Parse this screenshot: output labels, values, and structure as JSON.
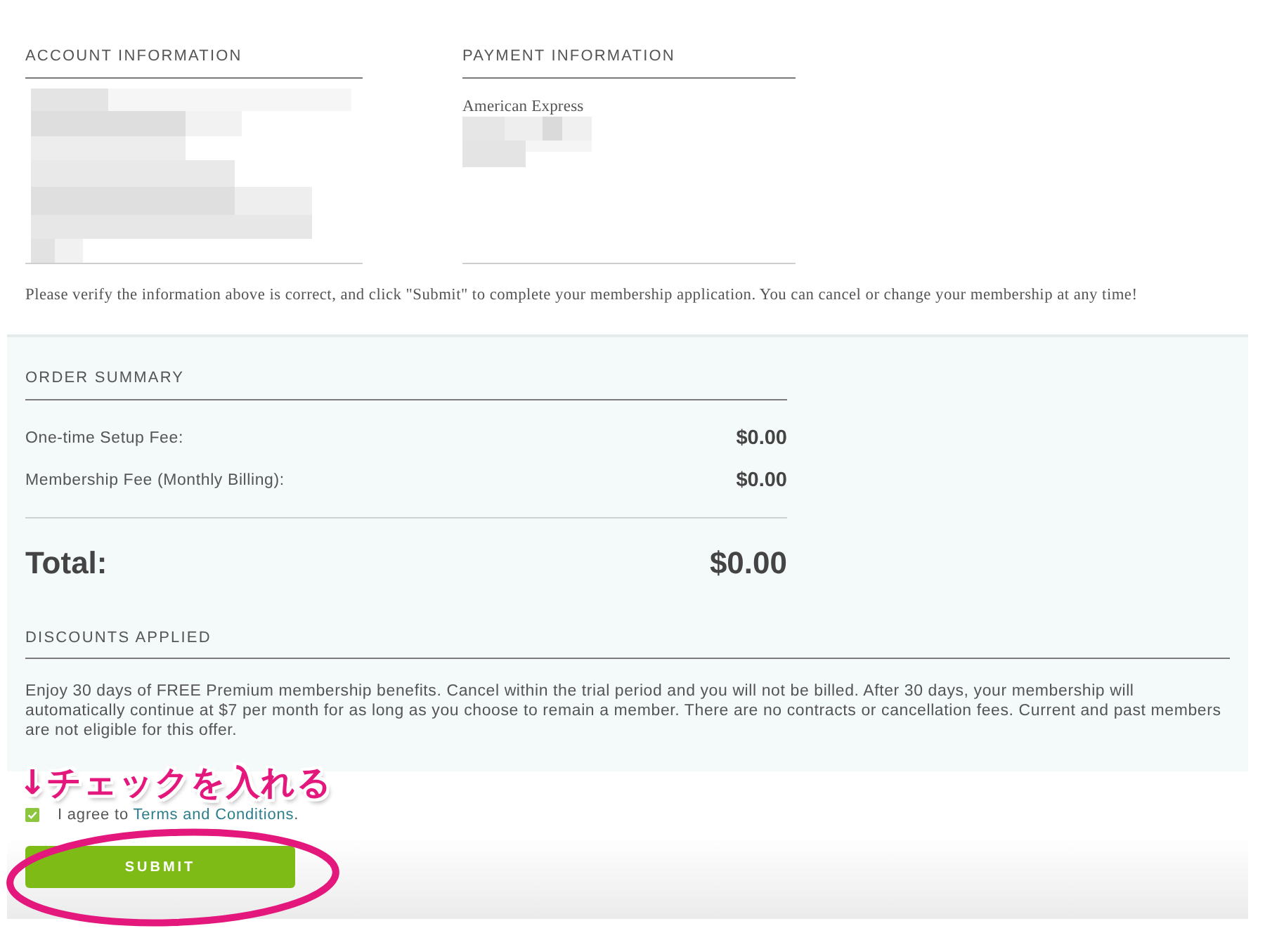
{
  "account_information": {
    "heading": "ACCOUNT INFORMATION",
    "redacted": true
  },
  "payment_information": {
    "heading": "PAYMENT INFORMATION",
    "card_type": "American Express",
    "redacted": true
  },
  "notice": "Please verify the information above is correct, and click \"Submit\" to complete your membership application. You can cancel or change your membership at any time!",
  "order_summary": {
    "heading": "ORDER SUMMARY",
    "fees": [
      {
        "label": "One-time Setup Fee:",
        "amount": "$0.00"
      },
      {
        "label": "Membership Fee (Monthly Billing):",
        "amount": "$0.00"
      }
    ],
    "total": {
      "label": "Total:",
      "amount": "$0.00"
    }
  },
  "discounts": {
    "heading": "DISCOUNTS APPLIED",
    "text": "Enjoy 30 days of FREE Premium membership benefits. Cancel within the trial period and you will not be billed. After 30 days, your membership will automatically continue at $7 per month for as long as you choose to remain a member. There are no contracts or cancellation fees. Current and past members are not eligible for this offer."
  },
  "agreement": {
    "checked": true,
    "prefix": "I agree to",
    "link": "Terms and Conditions",
    "suffix": "."
  },
  "submit_button": {
    "label": "SUBMIT"
  },
  "annotation": {
    "text": "↓チェックを入れる",
    "circled_button": true
  }
}
